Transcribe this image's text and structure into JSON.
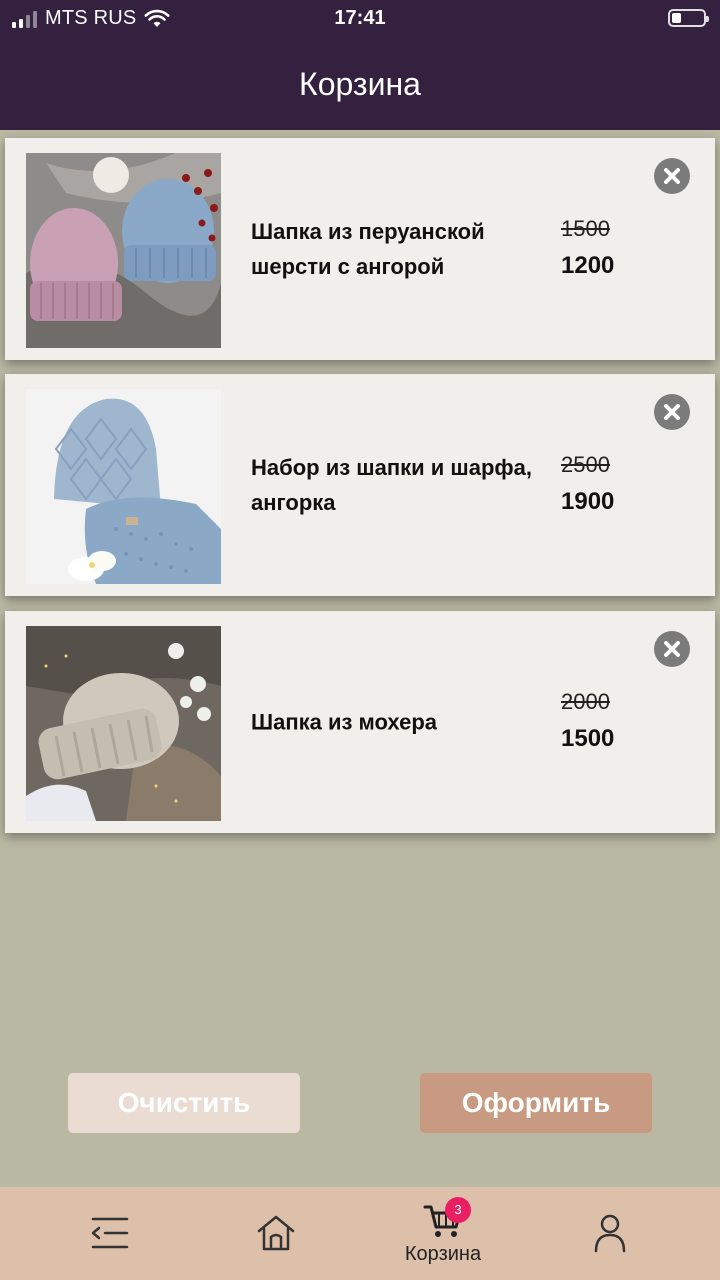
{
  "status_bar": {
    "carrier": "MTS RUS",
    "time": "17:41"
  },
  "header": {
    "title": "Корзина"
  },
  "cart": {
    "items": [
      {
        "name": "Шапка из перуанской шерсти с ангорой",
        "old_price": "1500",
        "price": "1200"
      },
      {
        "name": "Набор из шапки и шарфа, ангорка",
        "old_price": "2500",
        "price": "1900"
      },
      {
        "name": "Шапка из мохера",
        "old_price": "2000",
        "price": "1500"
      }
    ]
  },
  "actions": {
    "clear_label": "Очистить",
    "checkout_label": "Оформить"
  },
  "bottom_nav": {
    "active_label": "Корзина",
    "cart_badge": "3",
    "icons": [
      "menu-icon",
      "home-icon",
      "cart-icon",
      "profile-icon"
    ]
  },
  "colors": {
    "header_bg": "#33213f",
    "page_bg": "#b8b8a3",
    "card_bg": "#f0efec",
    "clear_button": "#ebdcd3",
    "checkout_button": "#c99a82",
    "nav_bg": "#ddc0aa",
    "badge": "#e91e63"
  }
}
